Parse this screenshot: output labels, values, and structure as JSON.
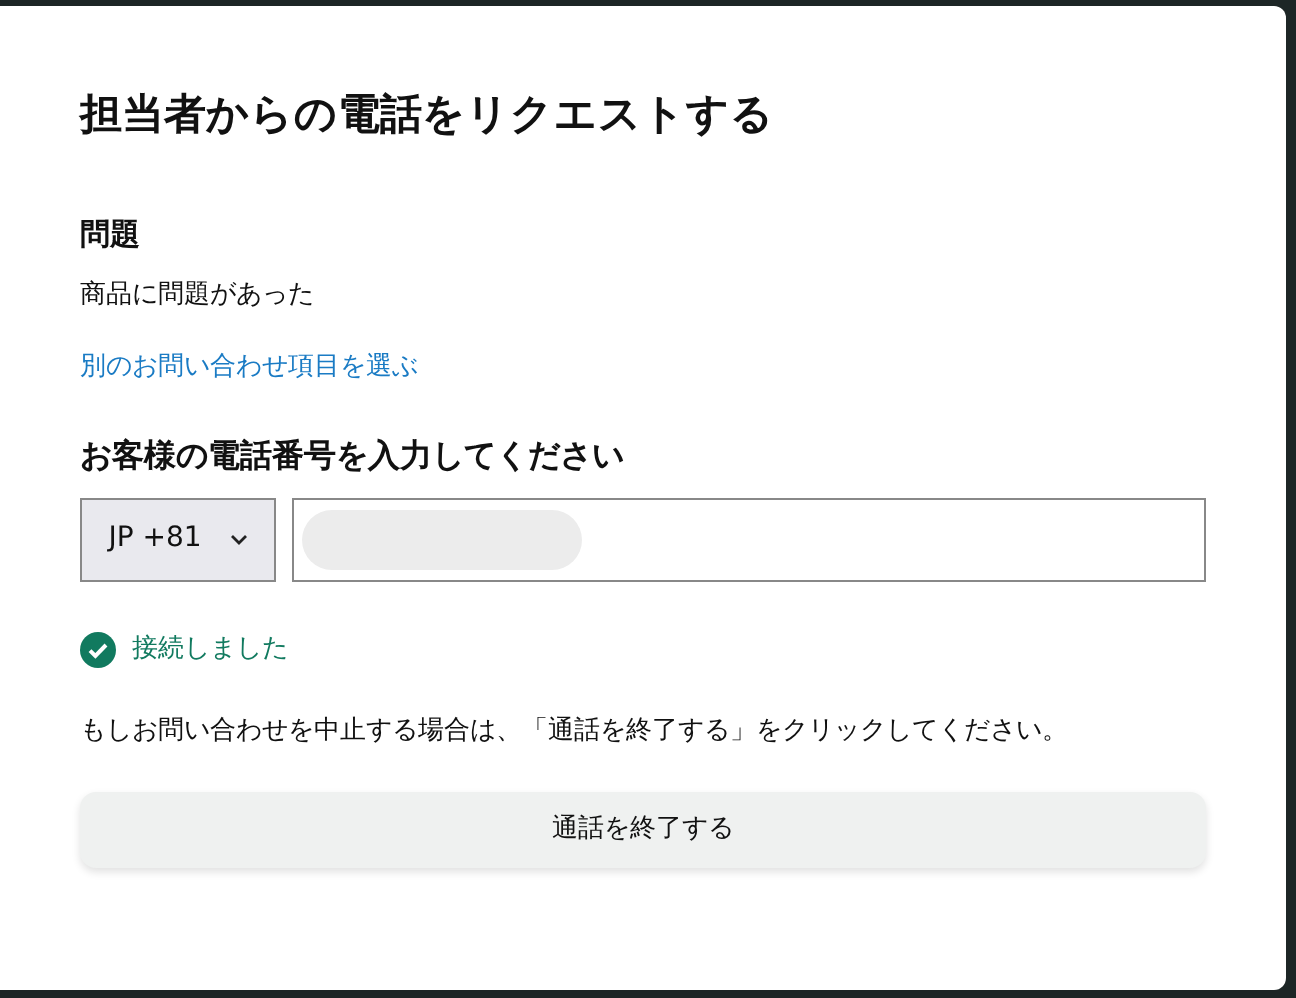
{
  "dialog": {
    "title": "担当者からの電話をリクエストする",
    "issue": {
      "heading": "問題",
      "value": "商品に問題があった",
      "change_link": "別のお問い合わせ項目を選ぶ"
    },
    "phone": {
      "heading": "お客様の電話番号を入力してください",
      "country_code": "JP +81",
      "number_redacted": true
    },
    "status": {
      "kind": "success",
      "text": "接続しました"
    },
    "instruction": "もしお問い合わせを中止する場合は、「通話を終了する」をクリックしてください。",
    "end_call_button": "通話を終了する"
  }
}
